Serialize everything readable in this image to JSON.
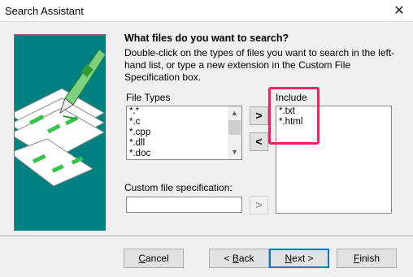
{
  "window": {
    "title": "Search Assistant",
    "close_glyph": "✕"
  },
  "heading": "What files do you want to search?",
  "description": "Double-click on the types of files you want to search in the left-hand list, or type a new extension in the Custom File Specification box.",
  "file_types": {
    "label": "File Types",
    "items": [
      "*.*",
      "*.c",
      "*.cpp",
      "*.dll",
      "*.doc"
    ]
  },
  "include": {
    "label": "Include",
    "items": [
      "*.txt",
      "*.html"
    ]
  },
  "move_right": ">",
  "move_left": "<",
  "custom_spec": {
    "label": "Custom file specification:",
    "value": "",
    "add": ">"
  },
  "buttons": {
    "cancel": {
      "mnemonic": "C",
      "rest": "ancel"
    },
    "back": {
      "prefix": "< ",
      "mnemonic": "B",
      "rest": "ack"
    },
    "next": {
      "mnemonic": "N",
      "rest": "ext >"
    },
    "finish": {
      "mnemonic": "F",
      "rest": "inish"
    }
  },
  "colors": {
    "art_background": "#008080",
    "highlight": "#f0235f",
    "default_button_border": "#0078d7"
  },
  "icons": {
    "close": "close-icon",
    "scroll_up": "scroll-up-icon",
    "scroll_down": "scroll-down-icon"
  }
}
